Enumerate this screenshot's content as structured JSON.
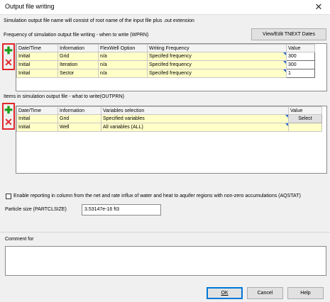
{
  "window": {
    "title": "Output file writing",
    "close_glyph": "✕"
  },
  "intro": "Simulation output file name will consist of root name of the input file plus .out extension",
  "wprn": {
    "heading": "Frequency of simulation output file writing - when to write (WPRN)",
    "view_button": "View/Edit TNEXT Dates",
    "columns": [
      "Date/Time",
      "Information",
      "FlexWell Option",
      "Writing Frequency",
      "Value"
    ],
    "rows": [
      {
        "date": "Initial",
        "info": "Grid",
        "flex": "n/a",
        "freq": "Specifed frequency",
        "value": "300"
      },
      {
        "date": "Initial",
        "info": "Iteration",
        "flex": "n/a",
        "freq": "Specifed frequency",
        "value": "300"
      },
      {
        "date": "Initial",
        "info": "Sector",
        "flex": "n/a",
        "freq": "Specifed frequency",
        "value": "1"
      }
    ]
  },
  "outprn": {
    "heading": "Items in simulation output file - what to write(OUTPRN)",
    "columns": [
      "Date/Time",
      "Information",
      "Variables selection",
      "Value"
    ],
    "rows": [
      {
        "date": "Initial",
        "info": "Grid",
        "vars": "Specified variables",
        "value": "Select"
      },
      {
        "date": "Initial",
        "info": "Well",
        "vars": "All variables (ALL)",
        "value": ""
      }
    ]
  },
  "aqstat_label": "Enable reporting in column from the net and rate influx of water and heat to aquifer regions with non-zero accumulations (AQSTAT)",
  "particle": {
    "label": "Particle size (PARTCLSIZE)",
    "value": "3.53147e-16 ft3"
  },
  "comment_label": "Comment for",
  "buttons": {
    "ok": "OK",
    "cancel": "Cancel",
    "help": "Help"
  },
  "icons": {
    "add": "plus-icon",
    "delete": "delete-icon"
  },
  "colors": {
    "highlight_red": "#e0262b",
    "add_green": "#1e9e1e",
    "cell_yellow": "#ffffc8"
  }
}
